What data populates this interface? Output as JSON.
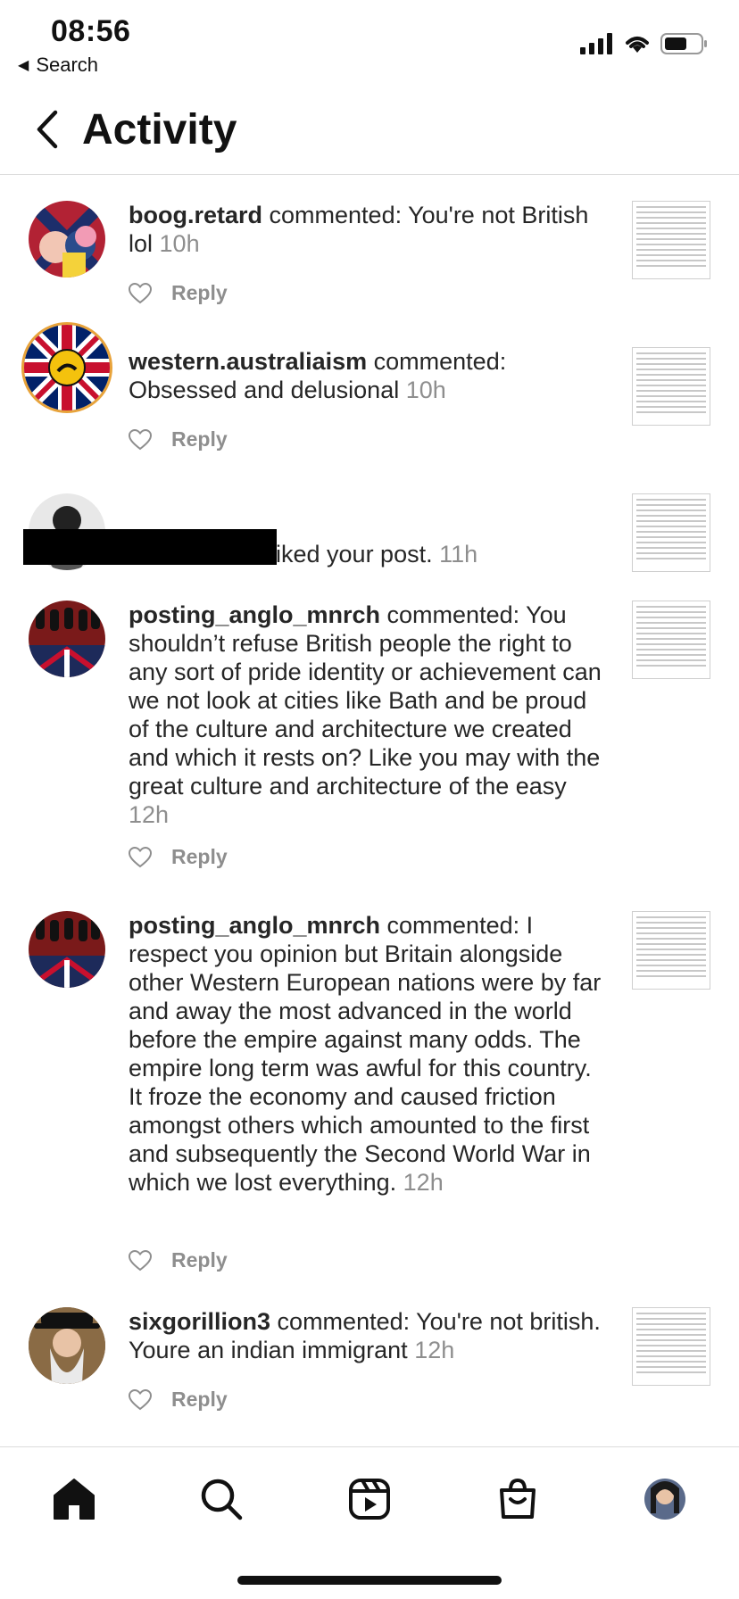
{
  "status_bar": {
    "time": "08:56",
    "back_app": "Search"
  },
  "header": {
    "title": "Activity"
  },
  "items": [
    {
      "user": "boog.retard",
      "text": " commented: You're not British lol",
      "time": "10h",
      "reply": "Reply"
    },
    {
      "user": "western.australiaism",
      "text": " commented: Obsessed and delusional",
      "time": "10h",
      "reply": "Reply"
    },
    {
      "user": "",
      "text": "iked your post.",
      "time": "11h",
      "reply": ""
    },
    {
      "user": "posting_anglo_mnrch",
      "text": " commented: You shouldn’t refuse British people the right to any sort of pride identity or achievement can we not look at cities like Bath and be proud of the culture and architecture we created and which it rests on? Like you may with the great culture and architecture of the easy",
      "time": "12h",
      "reply": "Reply"
    },
    {
      "user": "posting_anglo_mnrch",
      "text": " commented: I respect you opinion but Britain alongside other Western European nations were by far and away the most advanced in the world before the empire against many odds. The empire long term was awful for this country. It froze the economy and caused friction amongst others which amounted to the first and subsequently the Second World War in which we lost everything.",
      "time": "12h",
      "reply": "Reply"
    },
    {
      "user": "sixgorillion3",
      "text": " commented: You're not british. Youre an indian immigrant",
      "time": "12h",
      "reply": "Reply"
    }
  ],
  "tabs": [
    "home-icon",
    "search-icon",
    "reels-icon",
    "shop-icon",
    "profile-avatar"
  ],
  "colors": {
    "secondary_text": "#8e8e8e",
    "divider": "#dbdbdb"
  }
}
